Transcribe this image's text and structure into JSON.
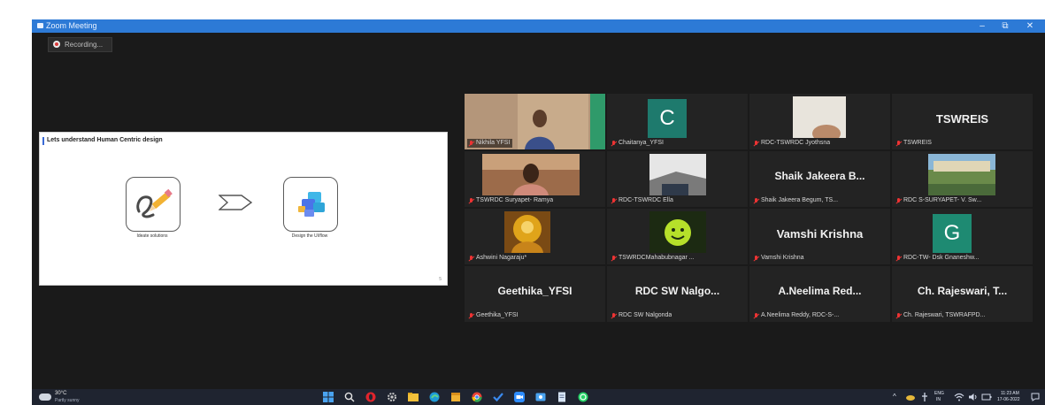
{
  "window": {
    "title": "Zoom Meeting",
    "controls": {
      "minimize": "–",
      "maximize": "⧉",
      "close": "✕"
    },
    "titlebar_color": "#2d7ad6"
  },
  "recording": {
    "label": "Recording..."
  },
  "shared_slide": {
    "title": "Lets understand Human Centric design",
    "cards": [
      {
        "icon": "pencil-icon",
        "caption": "Ideate solutions"
      },
      {
        "icon": "app-ui-icon",
        "caption": "Design the UI/flow"
      }
    ],
    "page_number": "5"
  },
  "participants": [
    {
      "name": "Nikhila YFSI",
      "display": "video",
      "active": true
    },
    {
      "name": "Chaitanya_YFSI",
      "display": "letter",
      "letter": "C",
      "color": "#1e7a6d"
    },
    {
      "name": "RDC-TSWRDC Jyothsna",
      "display": "video"
    },
    {
      "name": "TSWREIS",
      "display": "name",
      "big_name": "TSWREIS"
    },
    {
      "name": "TSWRDC Suryapet- Ramya",
      "display": "video"
    },
    {
      "name": "RDC-TSWRDC Ella",
      "display": "video"
    },
    {
      "name": "Shaik Jakeera Begum, TS...",
      "display": "name",
      "big_name": "Shaik Jakeera B..."
    },
    {
      "name": "RDC S-SURYAPET- V. Sw...",
      "display": "video"
    },
    {
      "name": "Ashwini Nagaraju*",
      "display": "video"
    },
    {
      "name": "TSWRDCMahabubnagar ...",
      "display": "video"
    },
    {
      "name": "Vamshi Krishna",
      "display": "name",
      "big_name": "Vamshi Krishna"
    },
    {
      "name": "RDC-TW- Dsk Gnaneshw...",
      "display": "letter",
      "letter": "G",
      "color": "#1e8a72"
    },
    {
      "name": "Geethika_YFSI",
      "display": "name",
      "big_name": "Geethika_YFSI"
    },
    {
      "name": "RDC SW Nalgonda",
      "display": "name",
      "big_name": "RDC SW Nalgo..."
    },
    {
      "name": "A.Neelima Reddy, RDC-S-...",
      "display": "name",
      "big_name": "A.Neelima Red..."
    },
    {
      "name": "Ch. Rajeswari, TSWRAFPD...",
      "display": "name",
      "big_name": "Ch. Rajeswari, T..."
    }
  ],
  "taskbar": {
    "weather": {
      "temp": "30°C",
      "desc": "Partly sunny"
    },
    "pinned_icons": [
      "windows-start-icon",
      "search-icon",
      "opera-icon",
      "settings-icon",
      "file-explorer-icon",
      "edge-icon",
      "sticky-notes-icon",
      "chrome-icon",
      "todo-icon",
      "zoom-icon",
      "photos-icon",
      "notepad-icon",
      "whatsapp-icon"
    ],
    "tray": {
      "language": "ENG",
      "region": "IN",
      "time": "11:23 AM",
      "date": "17-06-2022"
    }
  }
}
